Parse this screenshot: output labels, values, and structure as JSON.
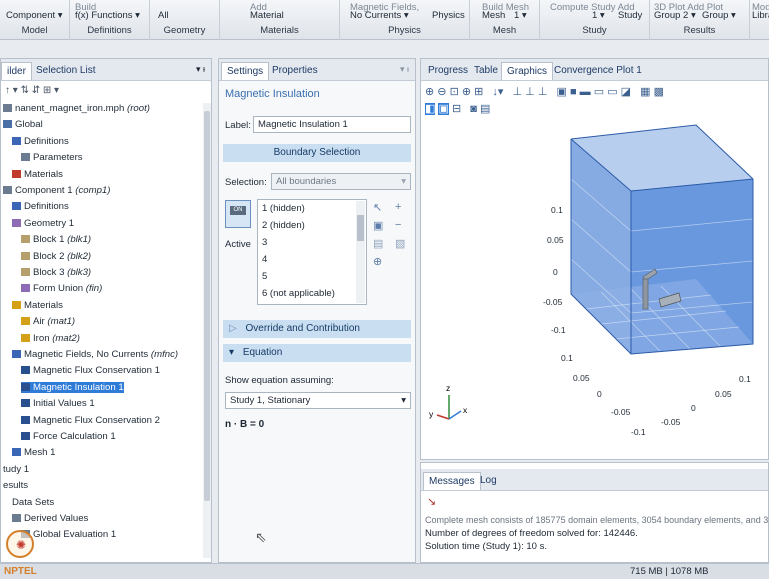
{
  "ribbon": {
    "groups": [
      {
        "name": "Model",
        "buttons": [
          "Component ▾"
        ]
      },
      {
        "name": "Definitions",
        "buttons": [
          "f(x) Functions ▾"
        ]
      },
      {
        "name": "Geometry",
        "buttons": [
          "All"
        ]
      },
      {
        "name": "Materials",
        "buttons": [
          "Material"
        ]
      },
      {
        "name": "Physics",
        "buttons": [
          "No Currents ▾",
          "Physics"
        ]
      },
      {
        "name": "Mesh",
        "buttons": [
          "Mesh",
          "1 ▾"
        ]
      },
      {
        "name": "Study",
        "buttons": [
          "Compute",
          "1 ▾",
          "Study"
        ]
      },
      {
        "name": "Results",
        "buttons": [
          "Group 2 ▾",
          "Group ▾"
        ]
      },
      {
        "name": "",
        "buttons": [
          "Librar"
        ]
      }
    ],
    "partial_top": [
      "Build",
      "Add",
      "Magnetic Fields,",
      "Build   Mesh",
      "Compute  Study   Add",
      "3D Plot   Add Plot",
      "Mod"
    ]
  },
  "model_builder": {
    "tabs": [
      "ilder",
      "Selection List"
    ],
    "pin": "▾ ᵻ",
    "tree": [
      {
        "text": "nanent_magnet_iron.mph",
        "suffix": "(root)",
        "level": 0,
        "icon": "file",
        "color": "#6b7b90"
      },
      {
        "text": "Global",
        "suffix": "",
        "level": 0,
        "icon": "globe",
        "color": "#4a6fa5"
      },
      {
        "text": "Definitions",
        "suffix": "",
        "level": 1,
        "icon": "defs",
        "color": "#3b66b5"
      },
      {
        "text": "Parameters",
        "suffix": "",
        "level": 2,
        "icon": "param",
        "color": "#6b7b90"
      },
      {
        "text": "Materials",
        "suffix": "",
        "level": 1,
        "icon": "material",
        "color": "#c0392b"
      },
      {
        "text": "Component 1",
        "suffix": "(comp1)",
        "level": 0,
        "icon": "component",
        "color": "#6b7b90"
      },
      {
        "text": "Definitions",
        "suffix": "",
        "level": 1,
        "icon": "defs",
        "color": "#3b66b5"
      },
      {
        "text": "Geometry 1",
        "suffix": "",
        "level": 1,
        "icon": "geometry",
        "color": "#8e6bb5"
      },
      {
        "text": "Block 1",
        "suffix": "(blk1)",
        "level": 2,
        "icon": "block",
        "color": "#b5a06b"
      },
      {
        "text": "Block 2",
        "suffix": "(blk2)",
        "level": 2,
        "icon": "block",
        "color": "#b5a06b"
      },
      {
        "text": "Block 3",
        "suffix": "(blk3)",
        "level": 2,
        "icon": "block",
        "color": "#b5a06b"
      },
      {
        "text": "Form Union",
        "suffix": "(fin)",
        "level": 2,
        "icon": "union",
        "color": "#8e6bb5"
      },
      {
        "text": "Materials",
        "suffix": "",
        "level": 1,
        "icon": "material",
        "color": "#d4a017"
      },
      {
        "text": "Air",
        "suffix": "(mat1)",
        "level": 2,
        "icon": "material",
        "color": "#d4a017"
      },
      {
        "text": "Iron",
        "suffix": "(mat2)",
        "level": 2,
        "icon": "material",
        "color": "#d4a017"
      },
      {
        "text": "Magnetic Fields, No Currents",
        "suffix": "(mfnc)",
        "level": 1,
        "icon": "physics",
        "color": "#3b66b5"
      },
      {
        "text": "Magnetic Flux Conservation 1",
        "suffix": "",
        "level": 2,
        "icon": "node",
        "color": "#2a4f8f"
      },
      {
        "text": "Magnetic Insulation 1",
        "suffix": "",
        "level": 2,
        "icon": "node",
        "color": "#2a4f8f",
        "selected": true
      },
      {
        "text": "Initial Values 1",
        "suffix": "",
        "level": 2,
        "icon": "node",
        "color": "#2a4f8f"
      },
      {
        "text": "Magnetic Flux Conservation 2",
        "suffix": "",
        "level": 2,
        "icon": "node",
        "color": "#2a4f8f"
      },
      {
        "text": "Force Calculation 1",
        "suffix": "",
        "level": 2,
        "icon": "node",
        "color": "#2a4f8f"
      },
      {
        "text": "Mesh 1",
        "suffix": "",
        "level": 1,
        "icon": "mesh",
        "color": "#3b66b5"
      },
      {
        "text": "tudy 1",
        "suffix": "",
        "level": 0,
        "icon": "none",
        "color": "#6b7b90"
      },
      {
        "text": "esults",
        "suffix": "",
        "level": 0,
        "icon": "none",
        "color": "#6b7b90"
      },
      {
        "text": "Data Sets",
        "suffix": "",
        "level": 1,
        "icon": "none",
        "color": "#6b7b90"
      },
      {
        "text": "Derived Values",
        "suffix": "",
        "level": 1,
        "icon": "derived",
        "color": "#6b7b90"
      },
      {
        "text": "Global Evaluation 1",
        "suffix": "",
        "level": 2,
        "icon": "eval",
        "color": "#6b7b90"
      }
    ]
  },
  "settings": {
    "tabs": [
      "Settings",
      "Properties"
    ],
    "pin": "▾ ᵻ",
    "title": "Magnetic Insulation",
    "label_caption": "Label:",
    "label_value": "Magnetic Insulation 1",
    "boundary_section": "Boundary Selection",
    "selection_caption": "Selection:",
    "selection_value": "All boundaries",
    "active_caption": "Active",
    "active_toggle": "ON",
    "boundaries": [
      "1 (hidden)",
      "2 (hidden)",
      "3",
      "4",
      "5",
      "6 (not applicable)"
    ],
    "override_section": "Override and Contribution",
    "equation_section": "Equation",
    "show_eq_caption": "Show equation assuming:",
    "study_value": "Study 1, Stationary",
    "equation": "n · B = 0"
  },
  "graphics": {
    "tabs": [
      "Progress",
      "Table",
      "Graphics",
      "Convergence Plot 1"
    ],
    "axis_ticks_z": [
      "0.1",
      "0.05",
      "0",
      "-0.05",
      "-0.1"
    ],
    "axis_ticks_x_front": [
      "0.1",
      "0.05",
      "0",
      "-0.05",
      "-0.1"
    ],
    "axis_ticks_y_right": [
      "0.1",
      "0.05",
      "0",
      "-0.05"
    ],
    "axis_labels": {
      "z": "z",
      "y": "y",
      "x": "x"
    }
  },
  "messages": {
    "tabs": [
      "Messages",
      "Log"
    ],
    "lines": [
      "Complete mesh consists of 185775 domain elements, 3054 boundary elements, and 312 edge",
      "Number of degrees of freedom solved for: 142446.",
      "Solution time (Study 1): 10 s."
    ]
  },
  "status": {
    "memory": "715 MB | 1078 MB",
    "watermark": "NPTEL"
  },
  "colors": {
    "selection": "#2f7bd8",
    "section_bg": "#c9dff1",
    "cube_face": "#4f86d9"
  }
}
